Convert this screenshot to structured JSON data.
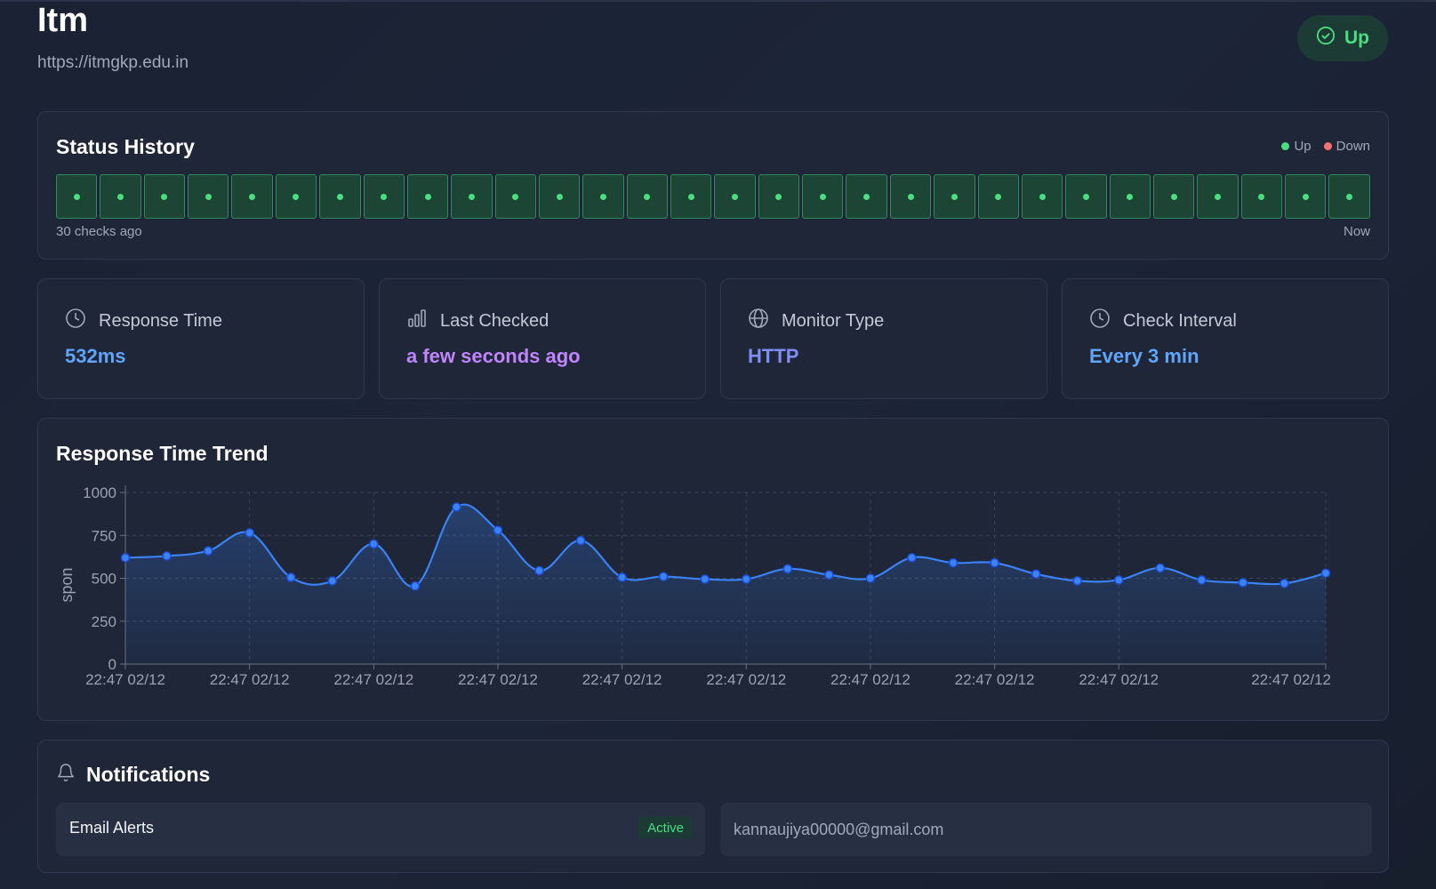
{
  "header": {
    "title": "Itm",
    "url": "https://itmgkp.edu.in",
    "status": "Up",
    "status_color": "#4ade80"
  },
  "status_history": {
    "title": "Status History",
    "legend": [
      {
        "label": "Up",
        "color": "#4ade80"
      },
      {
        "label": "Down",
        "color": "#f87171"
      }
    ],
    "checks": [
      "up",
      "up",
      "up",
      "up",
      "up",
      "up",
      "up",
      "up",
      "up",
      "up",
      "up",
      "up",
      "up",
      "up",
      "up",
      "up",
      "up",
      "up",
      "up",
      "up",
      "up",
      "up",
      "up",
      "up",
      "up",
      "up",
      "up",
      "up",
      "up",
      "up"
    ],
    "footer_left": "30 checks ago",
    "footer_right": "Now"
  },
  "stats": [
    {
      "label": "Response Time",
      "value": "532ms",
      "icon": "clock-icon",
      "color": "#60a5fa"
    },
    {
      "label": "Last Checked",
      "value": "a few seconds ago",
      "icon": "bar-chart-icon",
      "color": "#c084fc"
    },
    {
      "label": "Monitor Type",
      "value": "HTTP",
      "icon": "globe-icon",
      "color": "#818cf8"
    },
    {
      "label": "Check Interval",
      "value": "Every 3 min",
      "icon": "clock-icon",
      "color": "#60a5fa"
    }
  ],
  "trend": {
    "title": "Response Time Trend"
  },
  "chart_data": {
    "type": "area",
    "ylabel": "Response Ti",
    "ylim": [
      0,
      1000
    ],
    "y_ticks": [
      "0",
      "250",
      "500",
      "750",
      "1000"
    ],
    "x_tick_labels": [
      "22:47 02/12",
      "22:47 02/12",
      "22:47 02/12",
      "22:47 02/12",
      "22:47 02/12",
      "22:47 02/12",
      "22:47 02/12",
      "22:47 02/12",
      "22:47 02/12",
      "22:47 02/12"
    ],
    "grid": true,
    "series": [
      {
        "values": [
          620,
          630,
          660,
          765,
          505,
          485,
          700,
          455,
          915,
          780,
          545,
          720,
          505,
          510,
          495,
          495,
          555,
          520,
          500,
          620,
          590,
          590,
          525,
          485,
          490,
          560,
          490,
          475,
          470,
          530
        ],
        "color": "#3b82f6"
      }
    ]
  },
  "notifications": {
    "title": "Notifications",
    "email_label": "Email Alerts",
    "email_status": "Active",
    "email_address": "kannaujiya00000@gmail.com"
  }
}
